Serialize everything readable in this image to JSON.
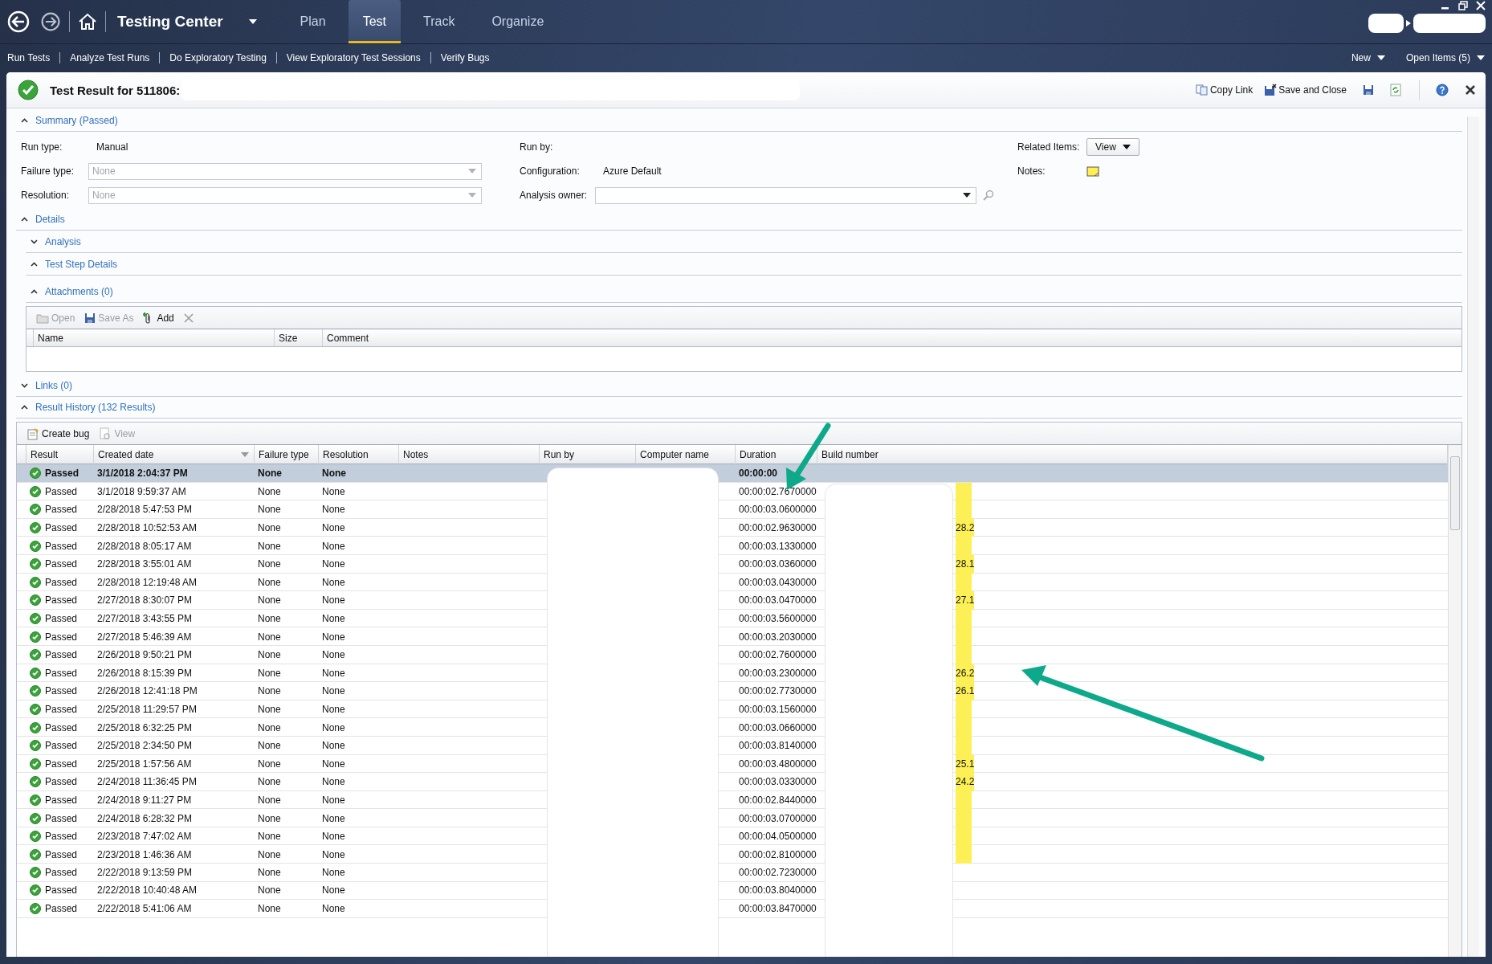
{
  "nav": {
    "title": "Testing Center",
    "tabs": [
      {
        "label": "Plan",
        "selected": false
      },
      {
        "label": "Test",
        "selected": true
      },
      {
        "label": "Track",
        "selected": false
      },
      {
        "label": "Organize",
        "selected": false
      }
    ],
    "links": [
      "Run Tests",
      "Analyze Test Runs",
      "Do Exploratory Testing",
      "View Exploratory Test Sessions",
      "Verify Bugs"
    ],
    "menus": [
      "New",
      "Open Items (5)"
    ]
  },
  "document": {
    "title": "Test Result for 511806:",
    "actions": [
      {
        "kind": "copy",
        "label": "Copy Link"
      },
      {
        "kind": "save-close",
        "label": "Save and Close"
      },
      {
        "kind": "save"
      },
      {
        "kind": "refresh"
      },
      {
        "kind": "help"
      },
      {
        "kind": "close"
      }
    ]
  },
  "summary": {
    "title": "Summary (Passed)",
    "expanded": true,
    "columns": [
      [
        {
          "label": "Run type:",
          "kind": "text",
          "value": "Manual"
        },
        {
          "label": "Failure type:",
          "kind": "dropdown",
          "value": "None",
          "disabled": true
        },
        {
          "label": "Resolution:",
          "kind": "dropdown",
          "value": "None",
          "disabled": true
        }
      ],
      [
        {
          "label": "Run by:",
          "kind": "text"
        },
        {
          "label": "Configuration:",
          "kind": "text",
          "value": "Azure Default"
        },
        {
          "label": "Analysis owner:",
          "kind": "dropdown",
          "disabled": false,
          "search": true
        }
      ],
      [
        {
          "label": "Related Items:",
          "kind": "button",
          "value": "View"
        },
        {
          "label": "Notes:",
          "kind": "note"
        }
      ]
    ]
  },
  "details": {
    "title": "Details",
    "expanded": true,
    "groups": [
      {
        "title": "Analysis",
        "expanded": false
      },
      {
        "title": "Test Step Details",
        "expanded": true
      }
    ],
    "attachments": {
      "title": "Attachments (0)",
      "expanded": true,
      "toolbar": [
        {
          "kind": "open",
          "label": "Open",
          "disabled": true
        },
        {
          "kind": "save",
          "label": "Save As",
          "disabled": true
        },
        {
          "kind": "add",
          "label": "Add",
          "disabled": false
        },
        {
          "kind": "delete",
          "disabled": true
        }
      ],
      "columns": [
        "Name",
        "Size",
        "Comment"
      ]
    }
  },
  "links": {
    "title": "Links (0)",
    "expanded": false
  },
  "history": {
    "title": "Result History (132 Results)",
    "expanded": true,
    "toolbar": [
      {
        "kind": "create-bug",
        "label": "Create bug",
        "disabled": false
      },
      {
        "kind": "view",
        "label": "View",
        "disabled": true
      }
    ],
    "columns": [
      {
        "label": "Result",
        "sorted": false
      },
      {
        "label": "Created date",
        "sorted": true
      },
      {
        "label": "Failure type",
        "sorted": false
      },
      {
        "label": "Resolution",
        "sorted": false
      },
      {
        "label": "Notes",
        "sorted": false
      },
      {
        "label": "Run by",
        "sorted": false
      },
      {
        "label": "Computer name",
        "sorted": false
      },
      {
        "label": "Duration",
        "sorted": false
      },
      {
        "label": "Build number",
        "sorted": false
      }
    ],
    "rows": [
      {
        "result": "Passed",
        "created": "3/1/2018 2:04:37 PM",
        "failure_type": "None",
        "resolution": "None",
        "duration": "00:00:00",
        "selected": true,
        "highlighted": false
      },
      {
        "result": "Passed",
        "created": "3/1/2018 9:59:37 AM",
        "failure_type": "None",
        "resolution": "None",
        "duration": "00:00:02.7670000",
        "selected": false,
        "highlighted": true
      },
      {
        "result": "Passed",
        "created": "2/28/2018 5:47:53 PM",
        "failure_type": "None",
        "resolution": "None",
        "duration": "00:00:03.0600000",
        "selected": false,
        "highlighted": true
      },
      {
        "result": "Passed",
        "created": "2/28/2018 10:52:53 AM",
        "failure_type": "None",
        "resolution": "None",
        "duration": "00:00:02.9630000",
        "build": "28.2",
        "selected": false,
        "highlighted": true
      },
      {
        "result": "Passed",
        "created": "2/28/2018 8:05:17 AM",
        "failure_type": "None",
        "resolution": "None",
        "duration": "00:00:03.1330000",
        "selected": false,
        "highlighted": true
      },
      {
        "result": "Passed",
        "created": "2/28/2018 3:55:01 AM",
        "failure_type": "None",
        "resolution": "None",
        "duration": "00:00:03.0360000",
        "build": "28.1",
        "selected": false,
        "highlighted": true
      },
      {
        "result": "Passed",
        "created": "2/28/2018 12:19:48 AM",
        "failure_type": "None",
        "resolution": "None",
        "duration": "00:00:03.0430000",
        "selected": false,
        "highlighted": true
      },
      {
        "result": "Passed",
        "created": "2/27/2018 8:30:07 PM",
        "failure_type": "None",
        "resolution": "None",
        "duration": "00:00:03.0470000",
        "build": "27.1",
        "selected": false,
        "highlighted": true
      },
      {
        "result": "Passed",
        "created": "2/27/2018 3:43:55 PM",
        "failure_type": "None",
        "resolution": "None",
        "duration": "00:00:03.5600000",
        "selected": false,
        "highlighted": true
      },
      {
        "result": "Passed",
        "created": "2/27/2018 5:46:39 AM",
        "failure_type": "None",
        "resolution": "None",
        "duration": "00:00:03.2030000",
        "selected": false,
        "highlighted": true
      },
      {
        "result": "Passed",
        "created": "2/26/2018 9:50:21 PM",
        "failure_type": "None",
        "resolution": "None",
        "duration": "00:00:02.7600000",
        "selected": false,
        "highlighted": true
      },
      {
        "result": "Passed",
        "created": "2/26/2018 8:15:39 PM",
        "failure_type": "None",
        "resolution": "None",
        "duration": "00:00:03.2300000",
        "build": "26.2",
        "selected": false,
        "highlighted": true
      },
      {
        "result": "Passed",
        "created": "2/26/2018 12:41:18 PM",
        "failure_type": "None",
        "resolution": "None",
        "duration": "00:00:02.7730000",
        "build": "26.1",
        "selected": false,
        "highlighted": true
      },
      {
        "result": "Passed",
        "created": "2/25/2018 11:29:57 PM",
        "failure_type": "None",
        "resolution": "None",
        "duration": "00:00:03.1560000",
        "selected": false,
        "highlighted": true
      },
      {
        "result": "Passed",
        "created": "2/25/2018 6:32:25 PM",
        "failure_type": "None",
        "resolution": "None",
        "duration": "00:00:03.0660000",
        "selected": false,
        "highlighted": true
      },
      {
        "result": "Passed",
        "created": "2/25/2018 2:34:50 PM",
        "failure_type": "None",
        "resolution": "None",
        "duration": "00:00:03.8140000",
        "selected": false,
        "highlighted": true
      },
      {
        "result": "Passed",
        "created": "2/25/2018 1:57:56 AM",
        "failure_type": "None",
        "resolution": "None",
        "duration": "00:00:03.4800000",
        "build": "25.1",
        "selected": false,
        "highlighted": true
      },
      {
        "result": "Passed",
        "created": "2/24/2018 11:36:45 PM",
        "failure_type": "None",
        "resolution": "None",
        "duration": "00:00:03.0330000",
        "build": "24.2",
        "selected": false,
        "highlighted": true
      },
      {
        "result": "Passed",
        "created": "2/24/2018 9:11:27 PM",
        "failure_type": "None",
        "resolution": "None",
        "duration": "00:00:02.8440000",
        "selected": false,
        "highlighted": true
      },
      {
        "result": "Passed",
        "created": "2/24/2018 6:28:32 PM",
        "failure_type": "None",
        "resolution": "None",
        "duration": "00:00:03.0700000",
        "selected": false,
        "highlighted": true
      },
      {
        "result": "Passed",
        "created": "2/23/2018 7:47:02 AM",
        "failure_type": "None",
        "resolution": "None",
        "duration": "00:00:04.0500000",
        "selected": false,
        "highlighted": true
      },
      {
        "result": "Passed",
        "created": "2/23/2018 1:46:36 AM",
        "failure_type": "None",
        "resolution": "None",
        "duration": "00:00:02.8100000",
        "selected": false,
        "highlighted": true
      },
      {
        "result": "Passed",
        "created": "2/22/2018 9:13:59 PM",
        "failure_type": "None",
        "resolution": "None",
        "duration": "00:00:02.7230000",
        "selected": false,
        "highlighted": false
      },
      {
        "result": "Passed",
        "created": "2/22/2018 10:40:48 AM",
        "failure_type": "None",
        "resolution": "None",
        "duration": "00:00:03.8040000",
        "selected": false,
        "highlighted": false
      },
      {
        "result": "Passed",
        "created": "2/22/2018 5:41:06 AM",
        "failure_type": "None",
        "resolution": "None",
        "duration": "00:00:03.8470000",
        "selected": false,
        "highlighted": false
      }
    ]
  }
}
